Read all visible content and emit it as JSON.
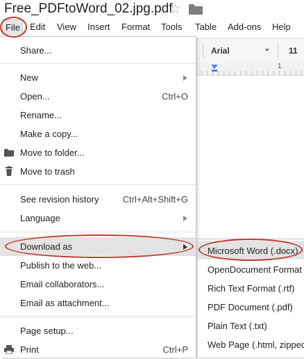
{
  "document": {
    "title": "Free_PDFtoWord_02.jpg.pdf",
    "star_icon": "star-outline-icon",
    "folder_icon": "folder-icon"
  },
  "menubar": {
    "items": [
      "File",
      "Edit",
      "View",
      "Insert",
      "Format",
      "Tools",
      "Table",
      "Add-ons",
      "Help"
    ],
    "active": "File"
  },
  "toolbar": {
    "font_name": "Arial",
    "font_size": "11",
    "ruler_mark": "1"
  },
  "file_menu": {
    "items": [
      {
        "label": "Share..."
      },
      {
        "label": "New",
        "submenu": true
      },
      {
        "label": "Open...",
        "shortcut": "Ctrl+O"
      },
      {
        "label": "Rename..."
      },
      {
        "label": "Make a copy..."
      },
      {
        "label": "Move to folder...",
        "icon": "folder-icon"
      },
      {
        "label": "Move to trash",
        "icon": "trash-icon"
      },
      {
        "label": "See revision history",
        "shortcut": "Ctrl+Alt+Shift+G"
      },
      {
        "label": "Language",
        "submenu": true
      },
      {
        "label": "Download as",
        "submenu": true,
        "highlighted": true
      },
      {
        "label": "Publish to the web..."
      },
      {
        "label": "Email collaborators..."
      },
      {
        "label": "Email as attachment..."
      },
      {
        "label": "Page setup..."
      },
      {
        "label": "Print",
        "shortcut": "Ctrl+P",
        "icon": "printer-icon"
      }
    ]
  },
  "download_submenu": {
    "items": [
      {
        "label": "Microsoft Word (.docx)",
        "highlighted": true
      },
      {
        "label": "OpenDocument Format ("
      },
      {
        "label": "Rich Text Format (.rtf)"
      },
      {
        "label": "PDF Document (.pdf)"
      },
      {
        "label": "Plain Text (.txt)"
      },
      {
        "label": "Web Page (.html, zipped"
      }
    ]
  },
  "colors": {
    "annotation_red": "#c0392b",
    "menu_highlight": "#e3e3e3",
    "ruler_blue": "#4a86e8"
  }
}
